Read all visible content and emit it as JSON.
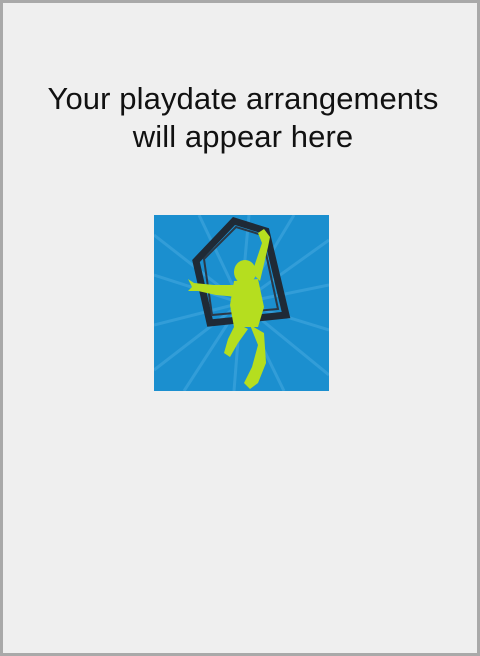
{
  "empty_state": {
    "message_line_1": "Your playdate arrangements",
    "message_line_2": "will appear here"
  },
  "logo": {
    "icon": "kid-jumping-house-logo",
    "colors": {
      "background": "#1b8fcf",
      "rays": "#3aa3dc",
      "house": "#1f2a36",
      "kid": "#b5de1f"
    }
  }
}
